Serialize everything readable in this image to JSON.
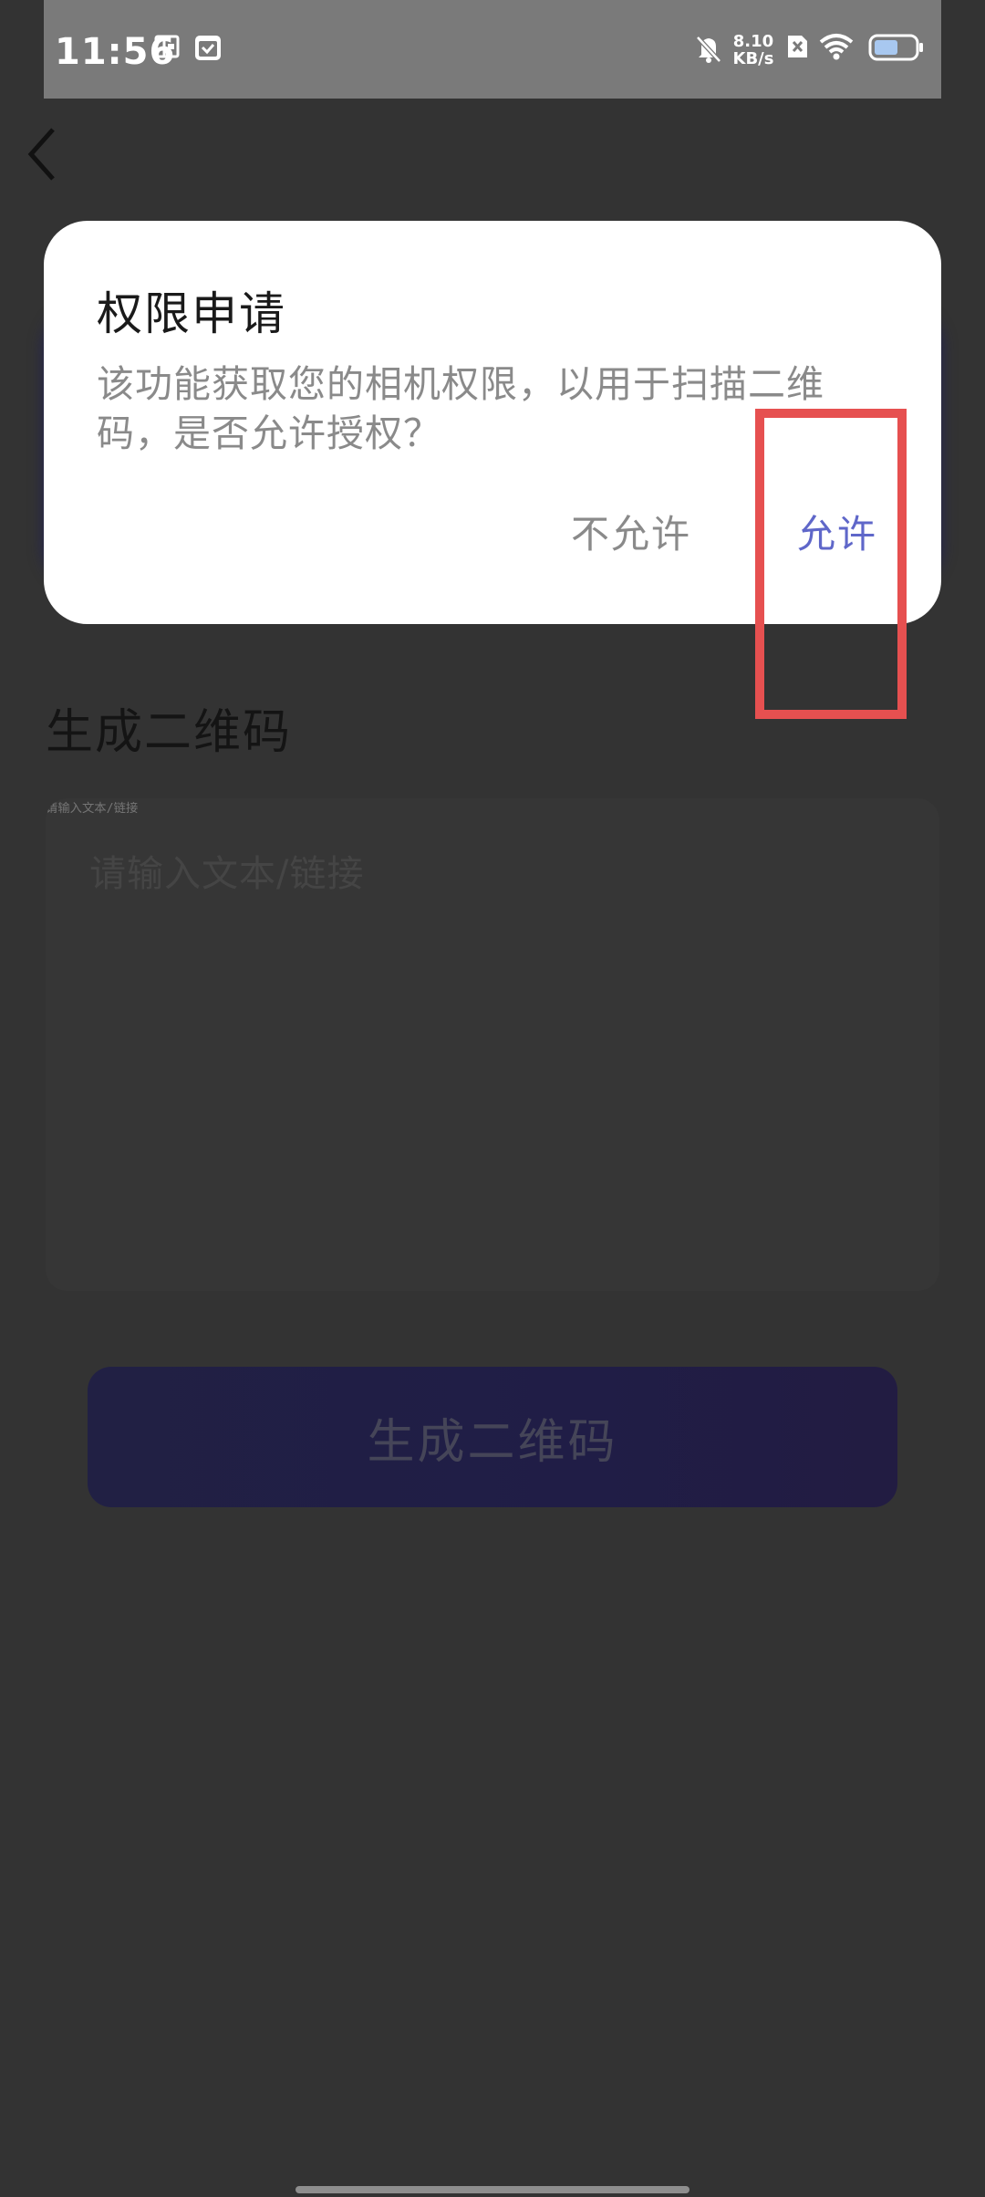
{
  "status_bar": {
    "time": "11:56",
    "net_speed_value": "8.10",
    "net_speed_unit": "KB/s",
    "icons": [
      "wallet-icon",
      "calendar-icon",
      "bell-off-icon",
      "sim-off-icon",
      "wifi-icon",
      "battery-icon"
    ],
    "battery_level": 0.6
  },
  "page": {
    "section_title": "生成二维码",
    "input": {
      "placeholder": "请输入文本/链接",
      "value": ""
    },
    "generate_button_label": "生成二维码"
  },
  "dialog": {
    "title": "权限申请",
    "message": "该功能获取您的相机权限，以用于扫描二维码，是否允许授权？",
    "deny_label": "不允许",
    "allow_label": "允许"
  },
  "colors": {
    "accent": "#5f67c9",
    "annotation": "#e65050",
    "overlay_background": "#333333"
  }
}
